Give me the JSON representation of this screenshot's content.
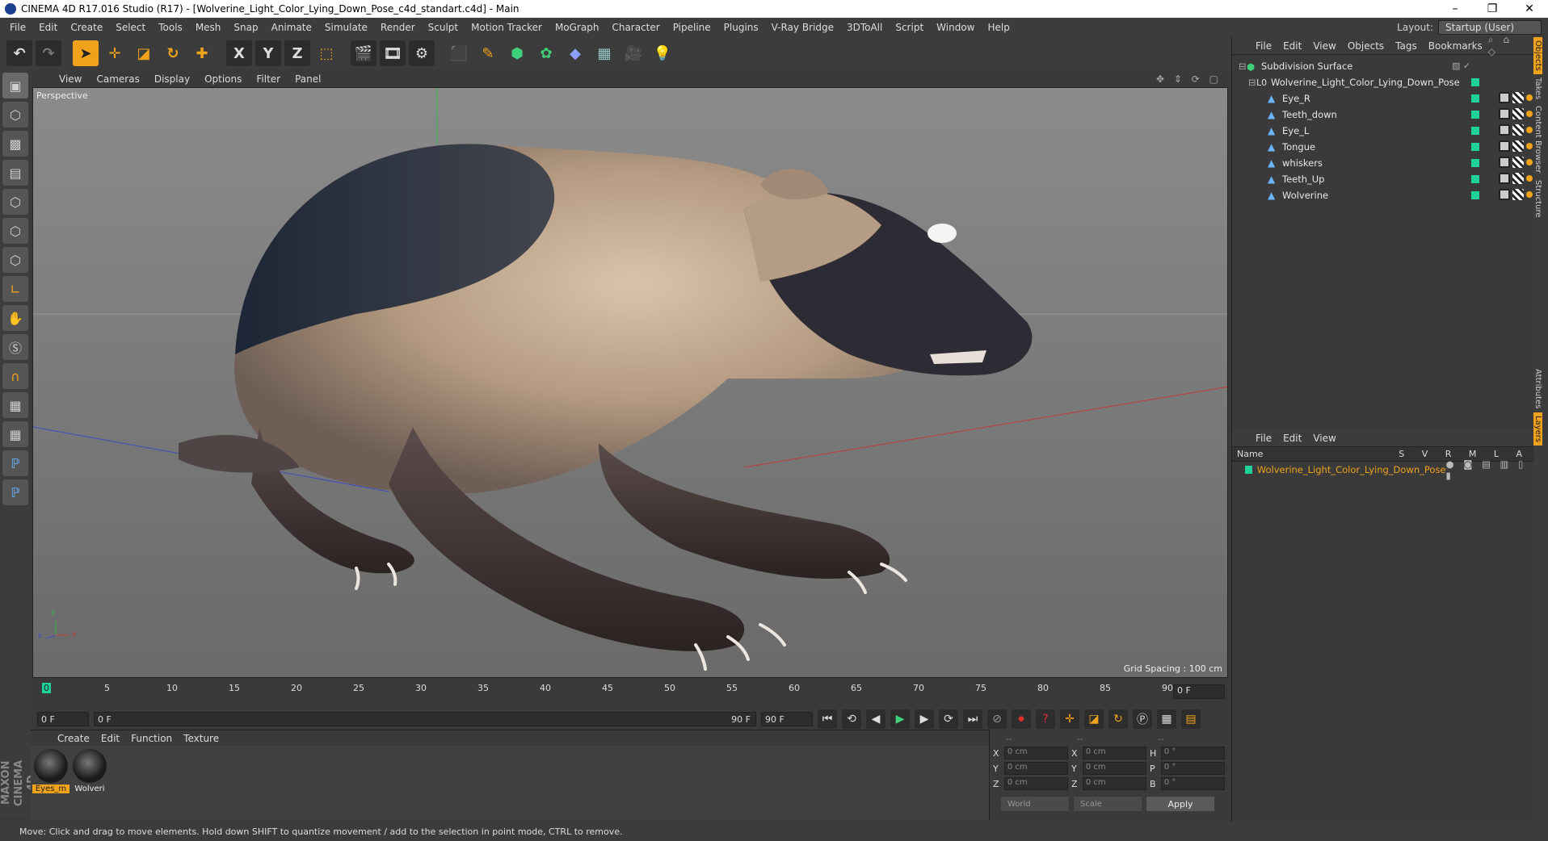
{
  "titlebar": {
    "title": "CINEMA 4D R17.016 Studio (R17) - [Wolverine_Light_Color_Lying_Down_Pose_c4d_standart.c4d] - Main",
    "minimize": "–",
    "restore": "❐",
    "close": "✕"
  },
  "menubar": {
    "items": [
      "File",
      "Edit",
      "Create",
      "Select",
      "Tools",
      "Mesh",
      "Snap",
      "Animate",
      "Simulate",
      "Render",
      "Sculpt",
      "Motion Tracker",
      "MoGraph",
      "Character",
      "Pipeline",
      "Plugins",
      "V-Ray Bridge",
      "3DToAll",
      "Script",
      "Window",
      "Help"
    ],
    "layout_label": "Layout:",
    "layout_value": "Startup (User)"
  },
  "toolbar": {
    "axis_x": "X",
    "axis_y": "Y",
    "axis_z": "Z"
  },
  "viewport": {
    "menu": [
      "View",
      "Cameras",
      "Display",
      "Options",
      "Filter",
      "Panel"
    ],
    "label": "Perspective",
    "grid_spacing": "Grid Spacing : 100 cm",
    "axis_x": "x",
    "axis_y": "y",
    "axis_z": "z"
  },
  "timeline": {
    "ticks": [
      "0",
      "5",
      "10",
      "15",
      "20",
      "25",
      "30",
      "35",
      "40",
      "45",
      "50",
      "55",
      "60",
      "65",
      "70",
      "75",
      "80",
      "85",
      "90"
    ],
    "current_frame": "0 F"
  },
  "transport": {
    "start": "0 F",
    "range_start": "0 F",
    "range_end": "90 F",
    "end": "90 F"
  },
  "material_manager": {
    "menu": [
      "Create",
      "Edit",
      "Function",
      "Texture"
    ],
    "materials": [
      {
        "name": "Eyes_m",
        "selected": true
      },
      {
        "name": "Wolveri",
        "selected": false
      }
    ]
  },
  "coordinates": {
    "header": [
      "--",
      "--",
      "--"
    ],
    "rows": [
      {
        "a1": "X",
        "v1": "0 cm",
        "a2": "X",
        "v2": "0 cm",
        "a3": "H",
        "v3": "0 °"
      },
      {
        "a1": "Y",
        "v1": "0 cm",
        "a2": "Y",
        "v2": "0 cm",
        "a3": "P",
        "v3": "0 °"
      },
      {
        "a1": "Z",
        "v1": "0 cm",
        "a2": "Z",
        "v2": "0 cm",
        "a3": "B",
        "v3": "0 °"
      }
    ],
    "space": "World",
    "mode": "Scale",
    "apply": "Apply"
  },
  "object_manager": {
    "menu": [
      "File",
      "Edit",
      "View",
      "Objects",
      "Tags",
      "Bookmarks"
    ],
    "objects": [
      {
        "name": "Subdivision Surface",
        "indent": 0
      },
      {
        "name": "Wolverine_Light_Color_Lying_Down_Pose",
        "indent": 1
      },
      {
        "name": "Eye_R",
        "indent": 2
      },
      {
        "name": "Teeth_down",
        "indent": 2
      },
      {
        "name": "Eye_L",
        "indent": 2
      },
      {
        "name": "Tongue",
        "indent": 2
      },
      {
        "name": "whiskers",
        "indent": 2
      },
      {
        "name": "Teeth_Up",
        "indent": 2
      },
      {
        "name": "Wolverine",
        "indent": 2
      }
    ]
  },
  "layer_manager": {
    "menu": [
      "File",
      "Edit",
      "View"
    ],
    "name_col": "Name",
    "cols": "S V R M L A",
    "layer": "Wolverine_Light_Color_Lying_Down_Pose"
  },
  "side_tabs": [
    "Objects",
    "Takes",
    "Content Browser",
    "Structure",
    "Attributes",
    "Layers"
  ],
  "status": "Move: Click and drag to move elements. Hold down SHIFT to quantize movement / add to the selection in point mode, CTRL to remove.",
  "logo": "MAXON CINEMA 4D",
  "colors": {
    "accent": "#f0a21b",
    "layer_green": "#1dd19a",
    "bone": "#6ab3ff"
  }
}
